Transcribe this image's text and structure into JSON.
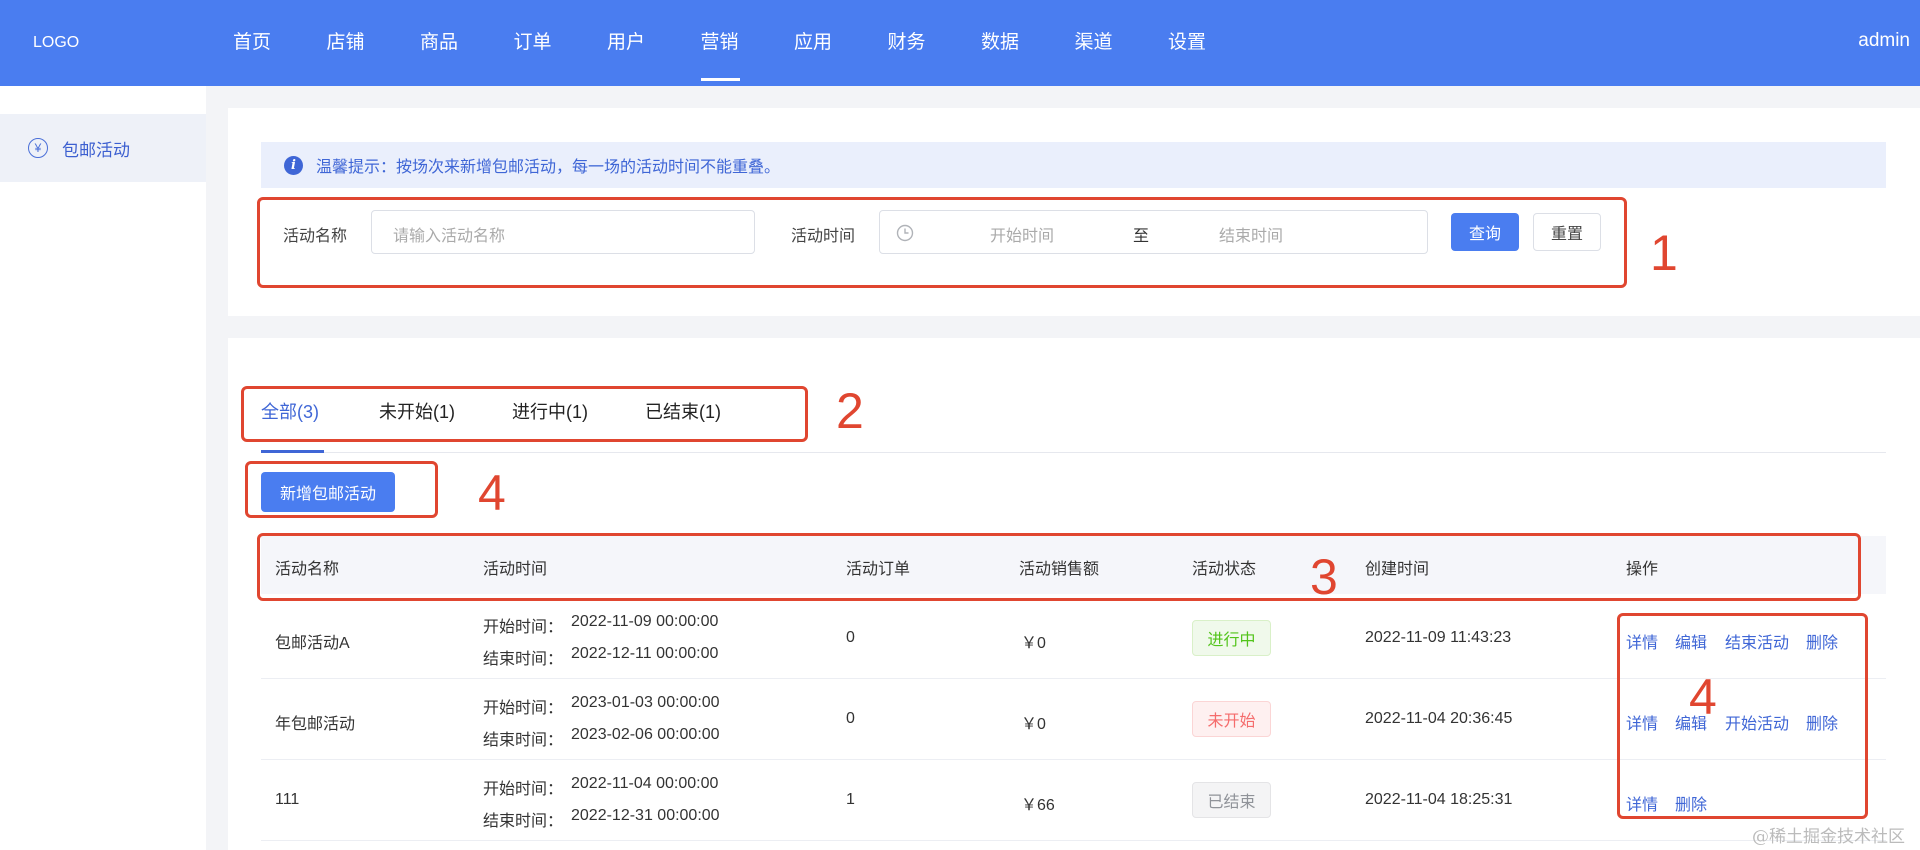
{
  "header": {
    "logo": "LOGO",
    "nav": [
      "首页",
      "店铺",
      "商品",
      "订单",
      "用户",
      "营销",
      "应用",
      "财务",
      "数据",
      "渠道",
      "设置"
    ],
    "active_nav": "营销",
    "user": "admin"
  },
  "sidebar": {
    "items": [
      {
        "label": "包邮活动",
        "icon": "yen-circle-icon"
      }
    ]
  },
  "tip": {
    "text": "温馨提示：按场次来新增包邮活动，每一场的活动时间不能重叠。"
  },
  "filter": {
    "name_label": "活动名称",
    "name_placeholder": "请输入活动名称",
    "time_label": "活动时间",
    "start_placeholder": "开始时间",
    "separator": "至",
    "end_placeholder": "结束时间",
    "query_button": "查询",
    "reset_button": "重置"
  },
  "tabs": [
    "全部(3)",
    "未开始(1)",
    "进行中(1)",
    "已结束(1)"
  ],
  "add_button": "新增包邮活动",
  "table": {
    "columns": [
      "活动名称",
      "活动时间",
      "活动订单",
      "活动销售额",
      "活动状态",
      "创建时间",
      "操作"
    ],
    "start_prefix": "开始时间：",
    "end_prefix": "结束时间：",
    "rows": [
      {
        "name": "包邮活动A",
        "start": "2022-11-09 00:00:00",
        "end": "2022-12-11 00:00:00",
        "orders": "0",
        "sales": "￥0",
        "status": "进行中",
        "created": "2022-11-09 11:43:23",
        "actions": [
          "详情",
          "编辑",
          "结束活动",
          "删除"
        ]
      },
      {
        "name": "年包邮活动",
        "start": "2023-01-03 00:00:00",
        "end": "2023-02-06 00:00:00",
        "orders": "0",
        "sales": "￥0",
        "status": "未开始",
        "created": "2022-11-04 20:36:45",
        "actions": [
          "详情",
          "编辑",
          "开始活动",
          "删除"
        ]
      },
      {
        "name": "111",
        "start": "2022-11-04 00:00:00",
        "end": "2022-12-31 00:00:00",
        "orders": "1",
        "sales": "￥66",
        "status": "已结束",
        "created": "2022-11-04 18:25:31",
        "actions": [
          "详情",
          "删除"
        ]
      }
    ]
  },
  "status_colors": {
    "进行中": {
      "text": "#52c41a",
      "bg": "#f0f9eb",
      "border": "#d9f0c8"
    },
    "未开始": {
      "text": "#f56c6c",
      "bg": "#fef0f0",
      "border": "#fbd5d5"
    },
    "已结束": {
      "text": "#909399",
      "bg": "#f4f4f5",
      "border": "#e4e4e6"
    }
  },
  "annotations": {
    "n1": "1",
    "n2": "2",
    "n3": "3",
    "n4a": "4",
    "n4b": "4"
  },
  "watermark": "@稀土掘金技术社区"
}
